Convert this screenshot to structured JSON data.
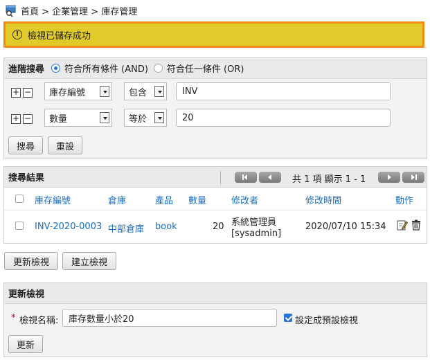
{
  "breadcrumb": {
    "icon": "inventory-icon",
    "text": "首頁 > 企業管理 > 庫存管理"
  },
  "alert": {
    "icon": "info-icon",
    "message": "檢視已儲存成功",
    "bg": "#e0cb2b",
    "border": "#f28b16"
  },
  "advanced_search": {
    "title": "進階搜尋",
    "match_all_label": "符合所有條件 (AND)",
    "match_any_label": "符合任一條件 (OR)",
    "selected": "AND",
    "criteria": [
      {
        "field": "庫存編號",
        "operator": "包含",
        "value": "INV"
      },
      {
        "field": "數量",
        "operator": "等於",
        "value": "20"
      }
    ],
    "search_button": "搜尋",
    "reset_button": "重設"
  },
  "results": {
    "title": "搜尋結果",
    "pager_text": "共 1 項 顯示 1 - 1",
    "columns": [
      "庫存編號",
      "倉庫",
      "產品",
      "數量",
      "修改者",
      "修改時間",
      "動作"
    ],
    "rows": [
      {
        "inventory_no": "INV-2020-0003",
        "warehouse": "中部倉庫",
        "product": "book",
        "quantity": "20",
        "modifier": "系統管理員",
        "modifier_account": "[sysadmin]",
        "modified_time": "2020/07/10 15:34"
      }
    ]
  },
  "view_buttons": {
    "update": "更新檢視",
    "create": "建立檢視"
  },
  "update_view": {
    "title": "更新檢視",
    "required_mark": "*",
    "name_label": "檢視名稱:",
    "name_value": "庫存數量小於20",
    "default_label": "設定成預設檢視",
    "default_checked": true,
    "update_button": "更新"
  },
  "colors": {
    "link": "#1a6fc2",
    "accent": "#2a72d8"
  }
}
